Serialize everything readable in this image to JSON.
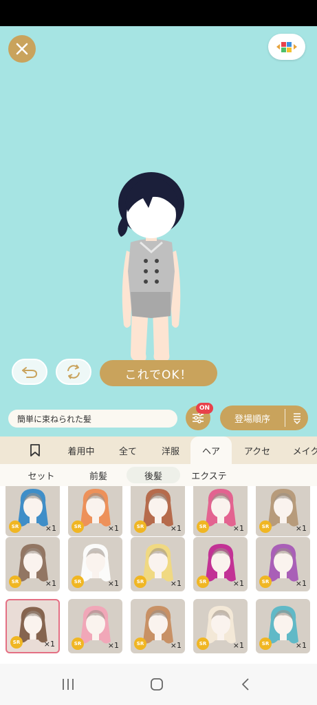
{
  "stage": {
    "ok_label": "これでOK！"
  },
  "toolbar": {
    "item_name": "簡単に束ねられた髪",
    "filter_badge": "ON",
    "sort_label": "登場順序"
  },
  "tabs": [
    {
      "label": "着用中"
    },
    {
      "label": "全て"
    },
    {
      "label": "洋服"
    },
    {
      "label": "ヘア",
      "active": true
    },
    {
      "label": "アクセ"
    },
    {
      "label": "メイク"
    }
  ],
  "subtabs": [
    {
      "label": "セット"
    },
    {
      "label": "前髪"
    },
    {
      "label": "後髪",
      "active": true
    },
    {
      "label": "エクステ"
    }
  ],
  "items": [
    {
      "rarity": "SR",
      "qty": "×1",
      "hair_color": "#2f86c8"
    },
    {
      "rarity": "SR",
      "qty": "×1",
      "hair_color": "#f0894e"
    },
    {
      "rarity": "SR",
      "qty": "×1",
      "hair_color": "#b25f3e"
    },
    {
      "rarity": "SR",
      "qty": "×1",
      "hair_color": "#e4578a"
    },
    {
      "rarity": "SR",
      "qty": "×1",
      "hair_color": "#b49572"
    },
    {
      "rarity": "SR",
      "qty": "×1",
      "hair_color": "#8b6b58"
    },
    {
      "rarity": "SR",
      "qty": "×1",
      "hair_color": "#ffffff"
    },
    {
      "rarity": "SR",
      "qty": "×1",
      "hair_color": "#f3d97a"
    },
    {
      "rarity": "SR",
      "qty": "×1",
      "hair_color": "#c0208f"
    },
    {
      "rarity": "SR",
      "qty": "×1",
      "hair_color": "#a452b5"
    },
    {
      "rarity": "SR",
      "qty": "×1",
      "hair_color": "#7a5640",
      "selected": true
    },
    {
      "rarity": "SR",
      "qty": "×1",
      "hair_color": "#f4a2b6"
    },
    {
      "rarity": "SR",
      "qty": "×1",
      "hair_color": "#c68a5a"
    },
    {
      "rarity": "SR",
      "qty": "×1",
      "hair_color": "#f6ead8"
    },
    {
      "rarity": "SR",
      "qty": "×1",
      "hair_color": "#53b6c6"
    }
  ],
  "colors": {
    "stage_bg": "#a6e4e3",
    "accent_gold": "#c9a35c",
    "badge_red": "#e8414b",
    "sr_yellow": "#f0b623",
    "selected_border": "#e46f83"
  },
  "icons": {
    "close": "close-icon",
    "palette": "palette-icon",
    "undo": "undo-icon",
    "rotate": "rotate-icon",
    "filter": "sliders-icon",
    "sort": "sort-icon",
    "bookmark": "bookmark-icon",
    "nav_recents": "recents-icon",
    "nav_home": "home-icon",
    "nav_back": "back-icon"
  }
}
